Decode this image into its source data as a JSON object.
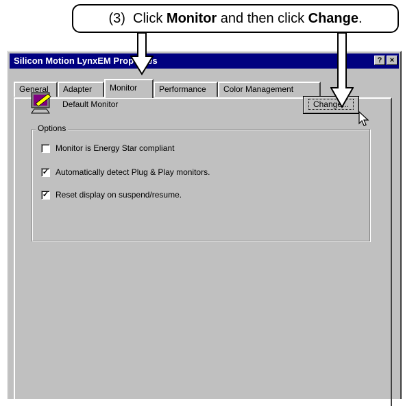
{
  "callout": {
    "prefix": "(3)  Click ",
    "bold1": "Monitor",
    "middle": " and then click ",
    "bold2": "Change",
    "suffix": "."
  },
  "window": {
    "title": "Silicon Motion LynxEM Properties",
    "help_label": "?",
    "close_label": "×"
  },
  "tabs": [
    {
      "label": "General"
    },
    {
      "label": "Adapter"
    },
    {
      "label": "Monitor"
    },
    {
      "label": "Performance"
    },
    {
      "label": "Color Management"
    }
  ],
  "monitor": {
    "name": "Default Monitor",
    "change_label": "Change..."
  },
  "options": {
    "group_label": "Options",
    "items": [
      {
        "label": "Monitor is Energy Star compliant",
        "checked": false
      },
      {
        "label": "Automatically detect Plug & Play monitors.",
        "checked": true
      },
      {
        "label": "Reset display on suspend/resume.",
        "checked": true
      }
    ]
  },
  "icons": {
    "monitor": "monitor-icon",
    "cursor": "mouse-pointer-icon",
    "arrow": "down-arrow-icon"
  }
}
